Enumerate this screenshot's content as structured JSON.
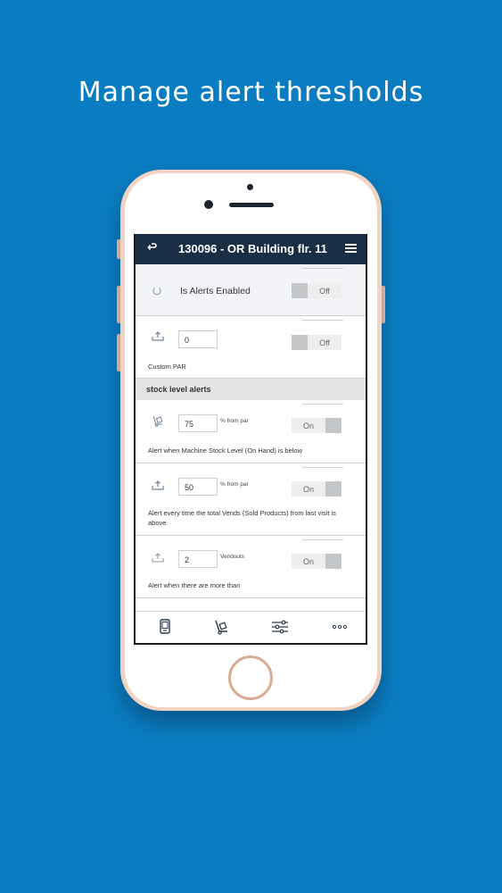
{
  "headline": "Manage alert thresholds",
  "nav": {
    "title": "130096 - OR Building flr. 11",
    "back_icon": "back-arrow-icon",
    "menu_icon": "hamburger-menu-icon"
  },
  "alerts_enabled": {
    "label": "Is Alerts Enabled",
    "toggle": "Off"
  },
  "custom_par": {
    "value": "0",
    "caption": "Custom PAR",
    "toggle": "Off"
  },
  "section": {
    "title": "stock level alerts"
  },
  "stock_alert": {
    "value": "75",
    "unit": "% from par",
    "caption": "Alert when Machine Stock Level (On Hand) is below",
    "toggle": "On"
  },
  "vends_alert": {
    "value": "50",
    "unit": "% from par",
    "caption": "Alert every time the total Vends (Sold Products) from last visit is above",
    "toggle": "On"
  },
  "vendouts_alert": {
    "value": "2",
    "unit": "Vendouts",
    "caption": "Alert when there are more than",
    "toggle": "On"
  },
  "tabbar": {
    "icons": [
      "machine-icon",
      "hand-truck-icon",
      "sliders-icon",
      "more-icon"
    ]
  },
  "colors": {
    "background": "#0a7cc1",
    "navbar": "#1a2f45",
    "phone_frame": "#f1d3c3"
  }
}
